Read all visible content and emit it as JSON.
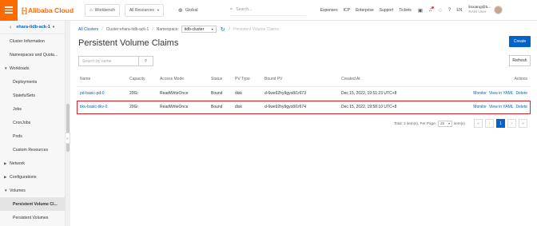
{
  "topbar": {
    "brand": "Alibaba Cloud",
    "workbench": "Workbench",
    "all_resources": "All Resources",
    "region": "Global",
    "search_placeholder": "Search...",
    "links": [
      "Expenses",
      "ICP",
      "Enterprise",
      "Support",
      "Tickets"
    ],
    "lang": "EN",
    "user_name": "linxiang@5...",
    "user_role": "RAM User",
    "accent": "#ff6a00"
  },
  "sidebar": {
    "cluster": "ehara-tidb-ack-1",
    "items": [
      {
        "type": "item",
        "label": "Cluster Information"
      },
      {
        "type": "item",
        "label": "Namespaces and Quota..."
      },
      {
        "type": "group",
        "label": "Workloads",
        "open": true
      },
      {
        "type": "sub",
        "label": "Deployments"
      },
      {
        "type": "sub",
        "label": "StatefulSets"
      },
      {
        "type": "sub",
        "label": "Jobs"
      },
      {
        "type": "sub",
        "label": "CronJobs"
      },
      {
        "type": "sub",
        "label": "Pods"
      },
      {
        "type": "sub",
        "label": "Custom Resources"
      },
      {
        "type": "group",
        "label": "Network",
        "open": false
      },
      {
        "type": "group",
        "label": "Configurations",
        "open": false
      },
      {
        "type": "group",
        "label": "Volumes",
        "open": true
      },
      {
        "type": "sub",
        "label": "Persistent Volume Cl...",
        "active": true
      },
      {
        "type": "sub",
        "label": "Persistent Volumes"
      }
    ]
  },
  "breadcrumb": {
    "all_clusters": "All Clusters",
    "cluster": "Cluster:ehara-tidb-ack-1",
    "namespace_label": "Namespace",
    "namespace_value": "tidb-cluster",
    "current": "Persistent Volume Claims"
  },
  "page": {
    "title": "Persistent Volume Claims",
    "create": "Create",
    "refresh": "Refresh",
    "search_placeholder": "Search by name"
  },
  "table": {
    "headers": {
      "name": "Name",
      "capacity": "Capacity",
      "access_mode": "Access Mode",
      "status": "Status",
      "pv_type": "PV Type",
      "bound_pv": "Bound PV",
      "created_at": "Created At",
      "actions": "Actions"
    },
    "rows": [
      {
        "name": "pd-basic-pd-0",
        "capacity": "20Gi",
        "access_mode": "ReadWriteOnce",
        "status": "Bound",
        "pv_type": "disk",
        "bound_pv": "d-6we92hy9gyo8i1r673",
        "created_at": "Dec 15, 2022, 19:51:23 UTC+8",
        "monitor": "Monitor",
        "view_yaml": "View in YAML",
        "delete": "Delete",
        "selected": false
      },
      {
        "name": "tikv-basic-tikv-0",
        "capacity": "20Gi",
        "access_mode": "ReadWriteOnce",
        "status": "Bound",
        "pv_type": "disk",
        "bound_pv": "d-6we92hy9gyo8i1r674",
        "created_at": "Dec 15, 2022, 19:58:10 UTC+8",
        "monitor": "Monitor",
        "view_yaml": "View in YAML",
        "delete": "Delete",
        "selected": true
      }
    ]
  },
  "pagination": {
    "total": "Total: 2 item(s), Per Page:",
    "per_page": "25",
    "items": "item(s)",
    "current_page": "1"
  }
}
